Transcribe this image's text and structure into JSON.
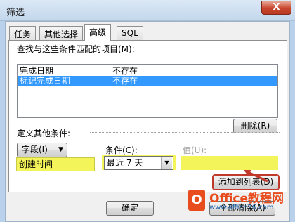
{
  "window": {
    "title": "筛选",
    "close": "X"
  },
  "tabs": [
    "任务",
    "其他选择",
    "高级",
    "SQL"
  ],
  "find_label": "查找与这些条件匹配的项目(M):",
  "criteria": [
    {
      "field": "完成日期",
      "condition": "不存在",
      "selected": false
    },
    {
      "field": "标记完成日期",
      "condition": "不存在",
      "selected": true
    }
  ],
  "remove_button": "删除(R)",
  "define_label": "定义其他条件:",
  "field_button": "字段(I)",
  "field_value": "创建时间",
  "condition_label": "条件(C):",
  "condition_value": "最近 7 天",
  "value_label": "值(U):",
  "value_value": "",
  "add_button": "添加到列表(D)",
  "ok_button": "确定",
  "clear_all_button": "全部清除(A)",
  "logo": {
    "brand": "Office教程网",
    "url": "www.office26.com"
  },
  "colors": {
    "highlight": "#f3f35a",
    "selection": "#3399ff",
    "annotation": "#c0392b"
  }
}
